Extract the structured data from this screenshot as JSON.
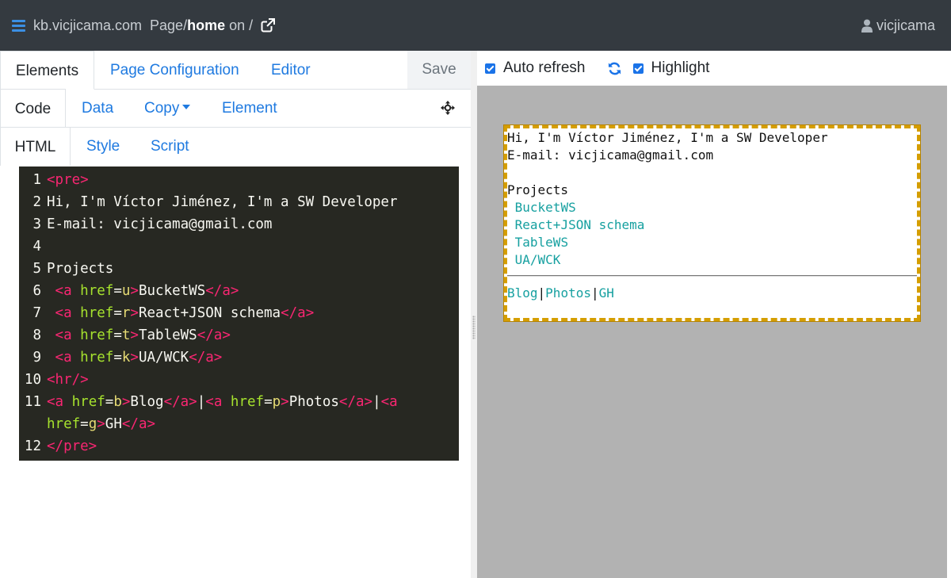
{
  "nav": {
    "site": "kb.vicjicama.com",
    "page_prefix": "Page/",
    "page_name": "home",
    "page_suffix": " on /",
    "user": "vicjicama"
  },
  "tabs": {
    "top": [
      "Elements",
      "Page Configuration",
      "Editor"
    ],
    "save": "Save",
    "second": [
      "Code",
      "Data",
      "Copy",
      "Element"
    ],
    "third": [
      "HTML",
      "Style",
      "Script"
    ]
  },
  "code_lines": [
    {
      "n": "1",
      "html": "<span class='t'>&lt;pre&gt;</span>"
    },
    {
      "n": "2",
      "html": "Hi, I'm Víctor Jiménez, I'm a SW Developer"
    },
    {
      "n": "3",
      "html": "E-mail: vicjicama@gmail.com"
    },
    {
      "n": "4",
      "html": ""
    },
    {
      "n": "5",
      "html": "Projects"
    },
    {
      "n": "6",
      "html": " <span class='t'>&lt;a</span> <span class='a'>href</span>=<span class='v'>u</span><span class='t'>&gt;</span>BucketWS<span class='t'>&lt;/a&gt;</span>"
    },
    {
      "n": "7",
      "html": " <span class='t'>&lt;a</span> <span class='a'>href</span>=<span class='v'>r</span><span class='t'>&gt;</span>React+JSON schema<span class='t'>&lt;/a&gt;</span>"
    },
    {
      "n": "8",
      "html": " <span class='t'>&lt;a</span> <span class='a'>href</span>=<span class='v'>t</span><span class='t'>&gt;</span>TableWS<span class='t'>&lt;/a&gt;</span>"
    },
    {
      "n": "9",
      "html": " <span class='t'>&lt;a</span> <span class='a'>href</span>=<span class='v'>k</span><span class='t'>&gt;</span>UA/WCK<span class='t'>&lt;/a&gt;</span>"
    },
    {
      "n": "10",
      "html": "<span class='t'>&lt;hr/&gt;</span>"
    },
    {
      "n": "11",
      "html": "<span class='t'>&lt;a</span> <span class='a'>href</span>=<span class='v'>b</span><span class='t'>&gt;</span>Blog<span class='t'>&lt;/a&gt;</span>|<span class='t'>&lt;a</span> <span class='a'>href</span>=<span class='v'>p</span><span class='t'>&gt;</span>Photos<span class='t'>&lt;/a&gt;</span>|<span class='t'>&lt;a</span>"
    },
    {
      "n": "",
      "html": "<span class='a'>href</span>=<span class='v'>g</span><span class='t'>&gt;</span>GH<span class='t'>&lt;/a&gt;</span>"
    },
    {
      "n": "12",
      "html": "<span class='t'>&lt;/pre&gt;</span>"
    }
  ],
  "toolbar": {
    "auto_refresh": "Auto refresh",
    "highlight": "Highlight"
  },
  "preview": {
    "line1": "Hi, I'm Víctor Jiménez, I'm a SW Developer",
    "line2": "E-mail: vicjicama@gmail.com",
    "projects": "Projects",
    "project_links": [
      "BucketWS",
      "React+JSON schema",
      "TableWS",
      "UA/WCK"
    ],
    "footer_links": [
      "Blog",
      "Photos",
      "GH"
    ],
    "separator": "|"
  },
  "colors": {
    "navbar": "#343a40",
    "link": "#1f7ae0",
    "editor_bg": "#272822",
    "highlight_border": "#d59e00",
    "preview_link": "#16a0a0"
  }
}
